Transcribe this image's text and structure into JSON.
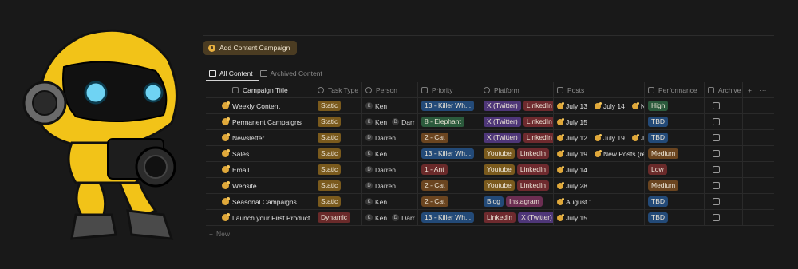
{
  "toolbar": {
    "add_label": "Add Content Campaign"
  },
  "tabs": [
    {
      "label": "All Content",
      "active": true
    },
    {
      "label": "Archived Content",
      "active": false
    }
  ],
  "columns": [
    "Campaign Title",
    "Task Type",
    "Person",
    "Priority",
    "Platform",
    "Posts",
    "Performance",
    "Archive"
  ],
  "header_actions": {
    "add": "+",
    "more": "···"
  },
  "rows": [
    {
      "title": "Weekly Content",
      "task": "Static",
      "task_style": "t-static",
      "people": [
        {
          "initial": "K",
          "name": "Ken"
        }
      ],
      "priority": "13 - Killer Wh...",
      "prio_style": "p-blue",
      "platforms": [
        {
          "label": "X (Twitter)",
          "style": "pl-purple"
        },
        {
          "label": "LinkedIn",
          "style": "pl-red"
        }
      ],
      "posts": [
        "July 13",
        "July 14",
        "N"
      ],
      "performance": "High",
      "perf_style": "pf-green"
    },
    {
      "title": "Permanent Campaigns",
      "task": "Static",
      "task_style": "t-static",
      "people": [
        {
          "initial": "K",
          "name": "Ken"
        },
        {
          "initial": "D",
          "name": "Darr"
        }
      ],
      "priority": "8 - Elephant",
      "prio_style": "p-green",
      "platforms": [
        {
          "label": "X (Twitter)",
          "style": "pl-purple"
        },
        {
          "label": "LinkedIn",
          "style": "pl-red"
        }
      ],
      "posts": [
        "July 15"
      ],
      "performance": "TBD",
      "perf_style": "pf-blue"
    },
    {
      "title": "Newsletter",
      "task": "Static",
      "task_style": "t-static",
      "people": [
        {
          "initial": "D",
          "name": "Darren"
        }
      ],
      "priority": "2 - Cat",
      "prio_style": "p-brown",
      "platforms": [
        {
          "label": "X (Twitter)",
          "style": "pl-purple"
        },
        {
          "label": "LinkedIn",
          "style": "pl-red"
        }
      ],
      "posts": [
        "July 12",
        "July 19",
        "J"
      ],
      "performance": "TBD",
      "perf_style": "pf-blue"
    },
    {
      "title": "Sales",
      "task": "Static",
      "task_style": "t-static",
      "people": [
        {
          "initial": "K",
          "name": "Ken"
        }
      ],
      "priority": "13 - Killer Wh...",
      "prio_style": "p-blue",
      "platforms": [
        {
          "label": "Youtube",
          "style": "pl-yellow"
        },
        {
          "label": "LinkedIn",
          "style": "pl-red"
        }
      ],
      "posts": [
        "July 19",
        "New Posts (re"
      ],
      "performance": "Medium",
      "perf_style": "pf-brown"
    },
    {
      "title": "Email",
      "task": "Static",
      "task_style": "t-static",
      "people": [
        {
          "initial": "D",
          "name": "Darren"
        }
      ],
      "priority": "1 - Ant",
      "prio_style": "p-red",
      "platforms": [
        {
          "label": "Youtube",
          "style": "pl-yellow"
        },
        {
          "label": "LinkedIn",
          "style": "pl-red"
        }
      ],
      "posts": [
        "July 14"
      ],
      "performance": "Low",
      "perf_style": "pf-red"
    },
    {
      "title": "Website",
      "task": "Static",
      "task_style": "t-static",
      "people": [
        {
          "initial": "D",
          "name": "Darren"
        }
      ],
      "priority": "2 - Cat",
      "prio_style": "p-brown",
      "platforms": [
        {
          "label": "Youtube",
          "style": "pl-yellow"
        },
        {
          "label": "LinkedIn",
          "style": "pl-red"
        }
      ],
      "posts": [
        "July 28"
      ],
      "performance": "Medium",
      "perf_style": "pf-brown"
    },
    {
      "title": "Seasonal Campaigns",
      "task": "Static",
      "task_style": "t-static",
      "people": [
        {
          "initial": "K",
          "name": "Ken"
        }
      ],
      "priority": "2 - Cat",
      "prio_style": "p-brown",
      "platforms": [
        {
          "label": "Blog",
          "style": "pl-blue"
        },
        {
          "label": "Instagram",
          "style": "pl-pink"
        }
      ],
      "posts": [
        "August 1"
      ],
      "performance": "TBD",
      "perf_style": "pf-blue"
    },
    {
      "title": "Launch your First Product",
      "task": "Dynamic",
      "task_style": "t-dynamic",
      "people": [
        {
          "initial": "K",
          "name": "Ken"
        },
        {
          "initial": "D",
          "name": "Darr"
        }
      ],
      "priority": "13 - Killer Wh...",
      "prio_style": "p-blue",
      "platforms": [
        {
          "label": "LinkedIn",
          "style": "pl-red"
        },
        {
          "label": "X (Twitter)",
          "style": "pl-purple"
        }
      ],
      "posts": [
        "July 15"
      ],
      "performance": "TBD",
      "perf_style": "pf-blue"
    }
  ],
  "new_label": "New"
}
